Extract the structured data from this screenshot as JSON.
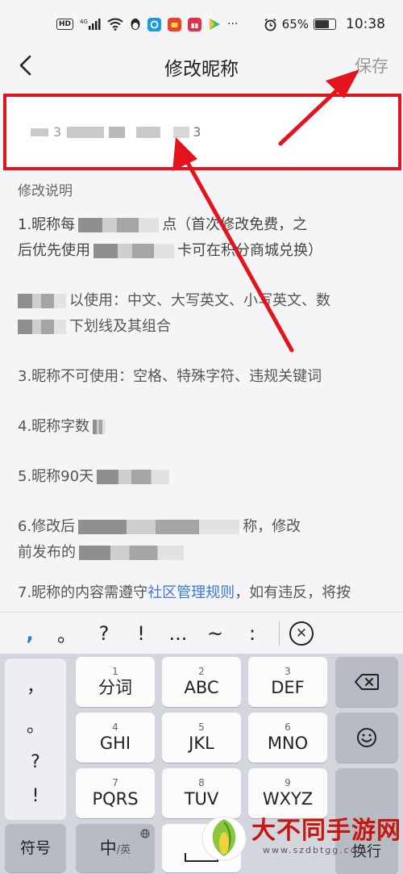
{
  "status_bar": {
    "hd": "HD",
    "network": "4G",
    "more": "···",
    "battery_text": "65%",
    "battery_level": 0.65,
    "time": "10:38"
  },
  "nav": {
    "back_icon": "chevron-left-icon",
    "title": "修改昵称",
    "save_label": "保存"
  },
  "input": {
    "visible_value": "3                     3"
  },
  "rules": {
    "title": "修改说明",
    "r1a": "1.昵称每",
    "r1b": "点（首次修改免费，之",
    "r1c": "后优先使用",
    "r1d": "卡可在积分商城兑换）",
    "r2a": "以使用：中文、大写英文、小写英文、数",
    "r2b": "下划线及其组合",
    "r3": "3.昵称不可使用：空格、特殊字符、违规关键词",
    "r4": "4.昵称字数",
    "r5": "5.昵称90天",
    "r6a": "6.修改后",
    "r6b": "称，修改",
    "r6c": "前发布的",
    "r7a": "7.昵称的内容需遵守",
    "r7_link": "社区管理规则",
    "r7b": "，如有违反，将按"
  },
  "quick_bar": {
    "symbols": [
      ",",
      "。",
      "?",
      "!",
      "...",
      "~",
      ":"
    ],
    "close_icon": "close-circle-icon"
  },
  "keyboard": {
    "punct": [
      "，",
      "。",
      "?",
      "!"
    ],
    "keys": [
      {
        "num": "1",
        "label": "分词"
      },
      {
        "num": "2",
        "label": "ABC"
      },
      {
        "num": "3",
        "label": "DEF"
      },
      {
        "num": "4",
        "label": "GHI"
      },
      {
        "num": "5",
        "label": "JKL"
      },
      {
        "num": "6",
        "label": "MNO"
      },
      {
        "num": "7",
        "label": "PQRS"
      },
      {
        "num": "8",
        "label": "TUV"
      },
      {
        "num": "9",
        "label": "WXYZ"
      }
    ],
    "delete_icon": "backspace-icon",
    "emoji_icon": "emoji-icon",
    "enter_label": "换行",
    "symbols_label": "符号",
    "lang_main": "中",
    "lang_alt": "/英",
    "globe_icon": "globe-icon"
  },
  "watermark": {
    "text": "大不同手游网",
    "url": "www.szdbtgg.com"
  },
  "colors": {
    "highlight_red": "#e3141b",
    "link_blue": "#3b78d8"
  }
}
